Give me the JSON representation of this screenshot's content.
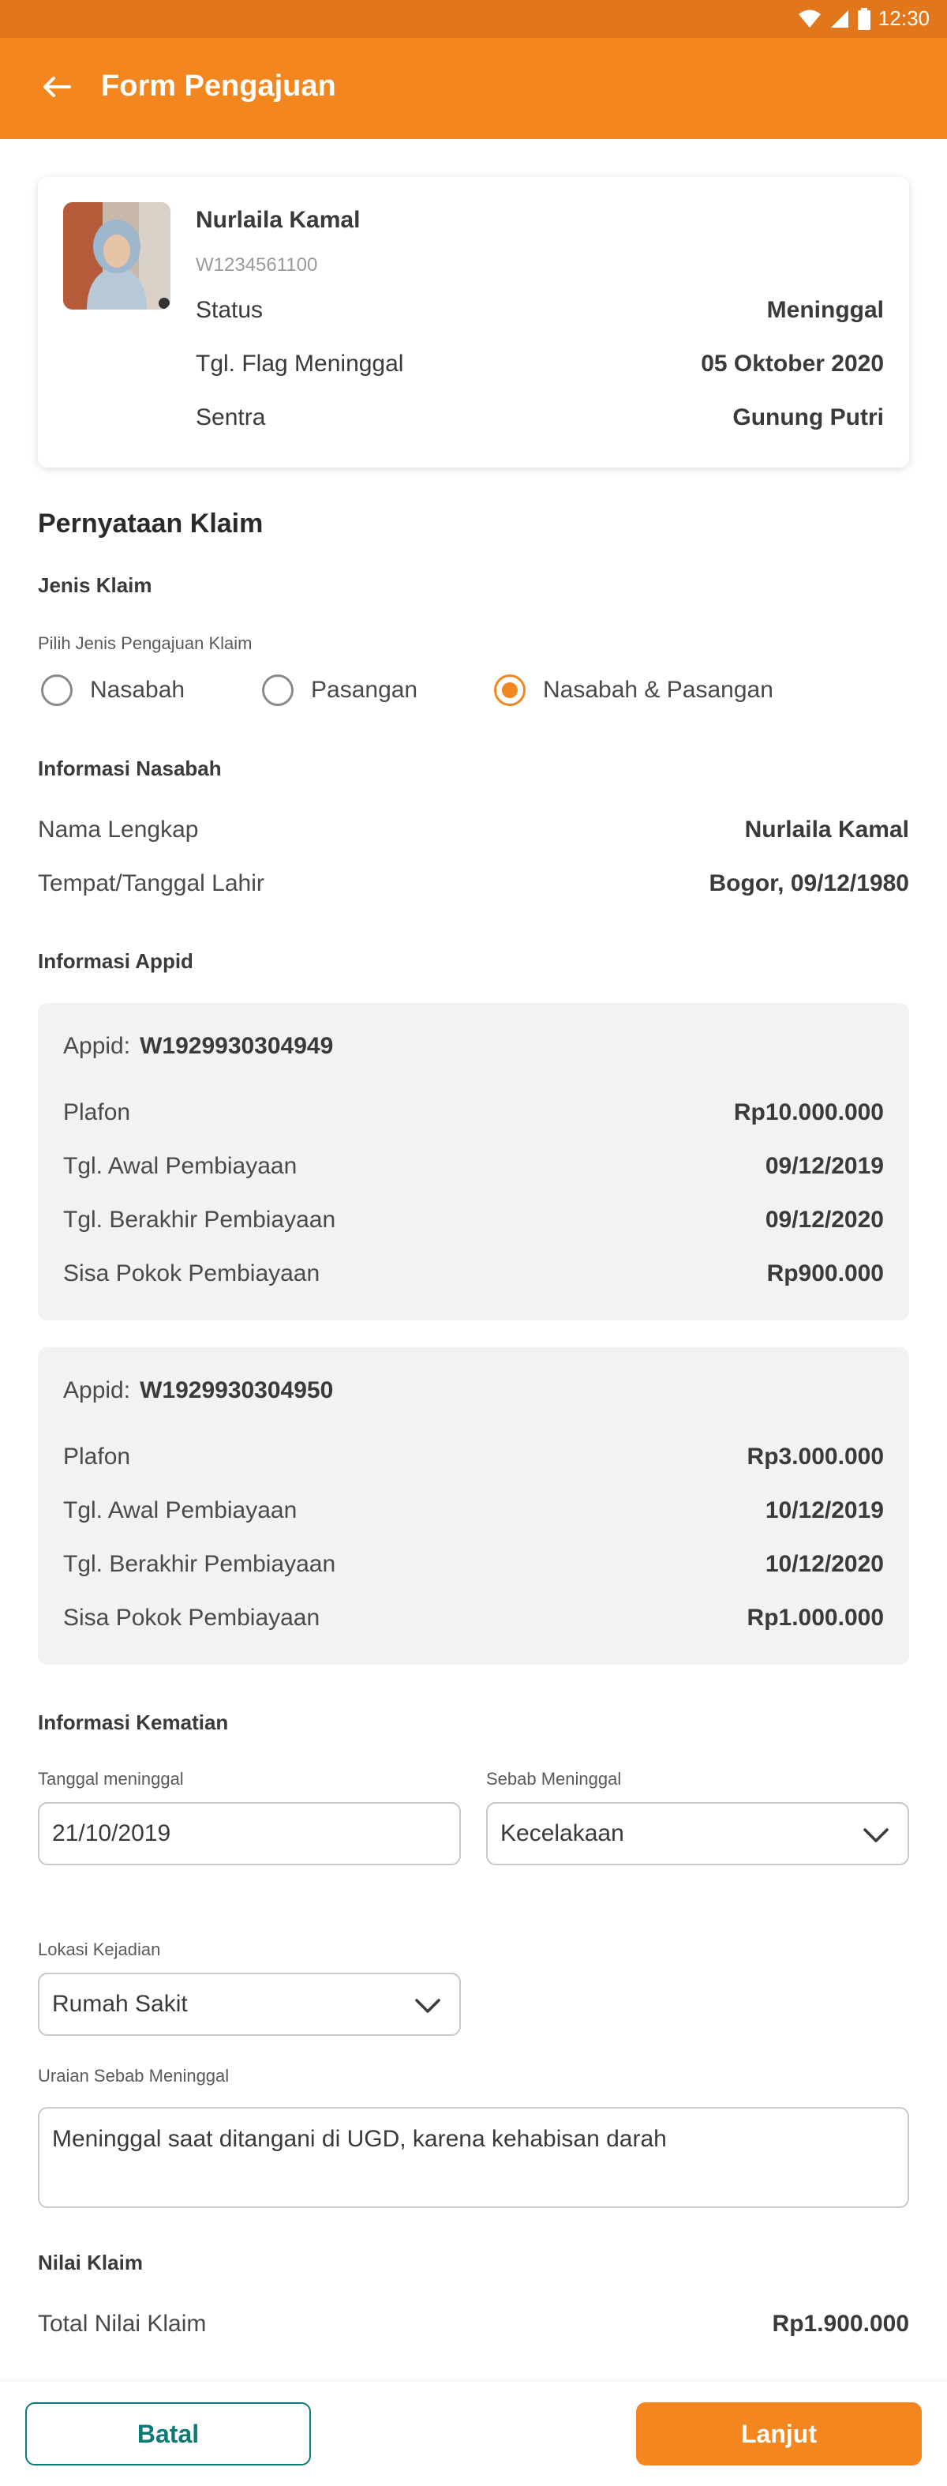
{
  "status_bar": {
    "time": "12:30"
  },
  "appbar": {
    "title": "Form Pengajuan"
  },
  "profile": {
    "name": "Nurlaila Kamal",
    "id": "W1234561100",
    "rows": [
      {
        "label": "Status",
        "value": "Meninggal"
      },
      {
        "label": "Tgl. Flag Meninggal",
        "value": "05 Oktober 2020"
      },
      {
        "label": "Sentra",
        "value": "Gunung Putri"
      }
    ]
  },
  "claim": {
    "section_title": "Pernyataan Klaim",
    "jenis_label": "Jenis Klaim",
    "pilih_label": "Pilih Jenis Pengajuan Klaim",
    "options": [
      "Nasabah",
      "Pasangan",
      "Nasabah & Pasangan"
    ],
    "selected_index": 2
  },
  "nasabah": {
    "title": "Informasi Nasabah",
    "rows": [
      {
        "label": "Nama Lengkap",
        "value": "Nurlaila Kamal"
      },
      {
        "label": "Tempat/Tanggal Lahir",
        "value": "Bogor, 09/12/1980"
      }
    ]
  },
  "appid": {
    "title": "Informasi Appid",
    "prefix": "Appid:",
    "cards": [
      {
        "id": "W1929930304949",
        "rows": [
          {
            "label": "Plafon",
            "value": "Rp10.000.000"
          },
          {
            "label": "Tgl. Awal Pembiayaan",
            "value": "09/12/2019"
          },
          {
            "label": "Tgl. Berakhir Pembiayaan",
            "value": "09/12/2020"
          },
          {
            "label": "Sisa Pokok Pembiayaan",
            "value": "Rp900.000"
          }
        ]
      },
      {
        "id": "W1929930304950",
        "rows": [
          {
            "label": "Plafon",
            "value": "Rp3.000.000"
          },
          {
            "label": "Tgl. Awal Pembiayaan",
            "value": "10/12/2019"
          },
          {
            "label": "Tgl. Berakhir Pembiayaan",
            "value": "10/12/2020"
          },
          {
            "label": "Sisa Pokok Pembiayaan",
            "value": "Rp1.000.000"
          }
        ]
      }
    ]
  },
  "kematian": {
    "title": "Informasi Kematian",
    "tanggal_label": "Tanggal meninggal",
    "tanggal_value": "21/10/2019",
    "sebab_label": "Sebab Meninggal",
    "sebab_value": "Kecelakaan",
    "lokasi_label": "Lokasi Kejadian",
    "lokasi_value": "Rumah Sakit",
    "uraian_label": "Uraian Sebab Meninggal",
    "uraian_value": "Meninggal saat ditangani di UGD, karena kehabisan darah"
  },
  "nilai": {
    "title": "Nilai Klaim",
    "total_label": "Total Nilai Klaim",
    "total_value": "Rp1.900.000"
  },
  "actions": {
    "cancel": "Batal",
    "next": "Lanjut"
  },
  "colors": {
    "primary": "#f4861f",
    "statusbar": "#e2761b",
    "teal": "#0e7a78"
  }
}
